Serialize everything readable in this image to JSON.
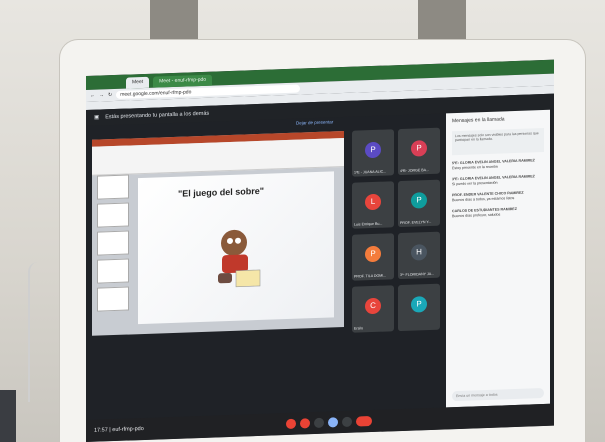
{
  "browser": {
    "tabs": [
      "Meet",
      "Meet - enuf-rfmp-pdo"
    ],
    "address": "meet.google.com/enuf-rfmp-pdo"
  },
  "meet": {
    "presenting_notice": "Estás presentando tu pantalla a los demás",
    "stop_presenting": "Dejar de presentar",
    "slide_title": "\"El juego del sobre\"",
    "participants": [
      {
        "initial": "P",
        "name": "1ºE - JUANA ALIC...",
        "color": "#5b4bc4"
      },
      {
        "initial": "P",
        "name": "4ºB- JORGE BA...",
        "color": "#d93f56"
      },
      {
        "initial": "L",
        "name": "Luis Enrique Bu...",
        "color": "#e8453c"
      },
      {
        "initial": "P",
        "name": "PROF. EVELYN Y...",
        "color": "#0f9d9d"
      },
      {
        "initial": "P",
        "name": "PROF. TILA DOMI...",
        "color": "#f47c3c"
      },
      {
        "initial": "H",
        "name": "3º- FLORIDANY JA...",
        "color": "#4a5560"
      },
      {
        "initial": "C",
        "name": "Ersilo",
        "color": "#e8453c"
      },
      {
        "initial": "P",
        "name": "",
        "color": "#1aa8b8"
      }
    ],
    "chat": {
      "title": "Mensajes en la llamada",
      "note": "Los mensajes solo son visibles para las personas que participan en la llamada.",
      "messages": [
        {
          "sender": "5ºE: GLORIA EVELIN ANGEL VALERIA RAMIREZ",
          "text": "Estoy presente en la reunión"
        },
        {
          "sender": "3ºE: GLORIA EVELIN ANGEL VALERIA RAMIREZ",
          "text": "Si puedo ver la presentación"
        },
        {
          "sender": "PROF. ENDER VALENTE CHICO RAMIREZ",
          "text": "Buenos días a todos, ya estamos listos"
        },
        {
          "sender": "CARLOS DE ESTUDIANTES RAMIREZ",
          "text": "Buenos días profesor, saludos"
        }
      ],
      "input_placeholder": "Envía un mensaje a todos"
    },
    "meeting_time": "17:57",
    "meeting_code": "euf-rfmp-pdo"
  }
}
